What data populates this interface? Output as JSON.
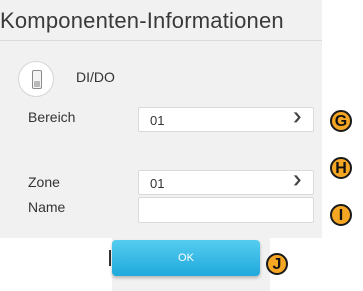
{
  "dialog": {
    "title": "Komponenten-Informationen",
    "device_label": "DI/DO",
    "device_icon": "wall-switch-icon"
  },
  "form": {
    "bereich": {
      "label": "Bereich",
      "value": "01"
    },
    "zone": {
      "label": "Zone",
      "value": "01"
    },
    "name": {
      "label": "Name",
      "value": ""
    }
  },
  "buttons": {
    "ok_label": "OK"
  },
  "annotations": {
    "g": "G",
    "h": "H",
    "i": "I",
    "j": "J"
  },
  "colors": {
    "ok_button": "#2fb7e6",
    "badge": "#f5a623",
    "panel_bg": "#f1f1f1"
  }
}
